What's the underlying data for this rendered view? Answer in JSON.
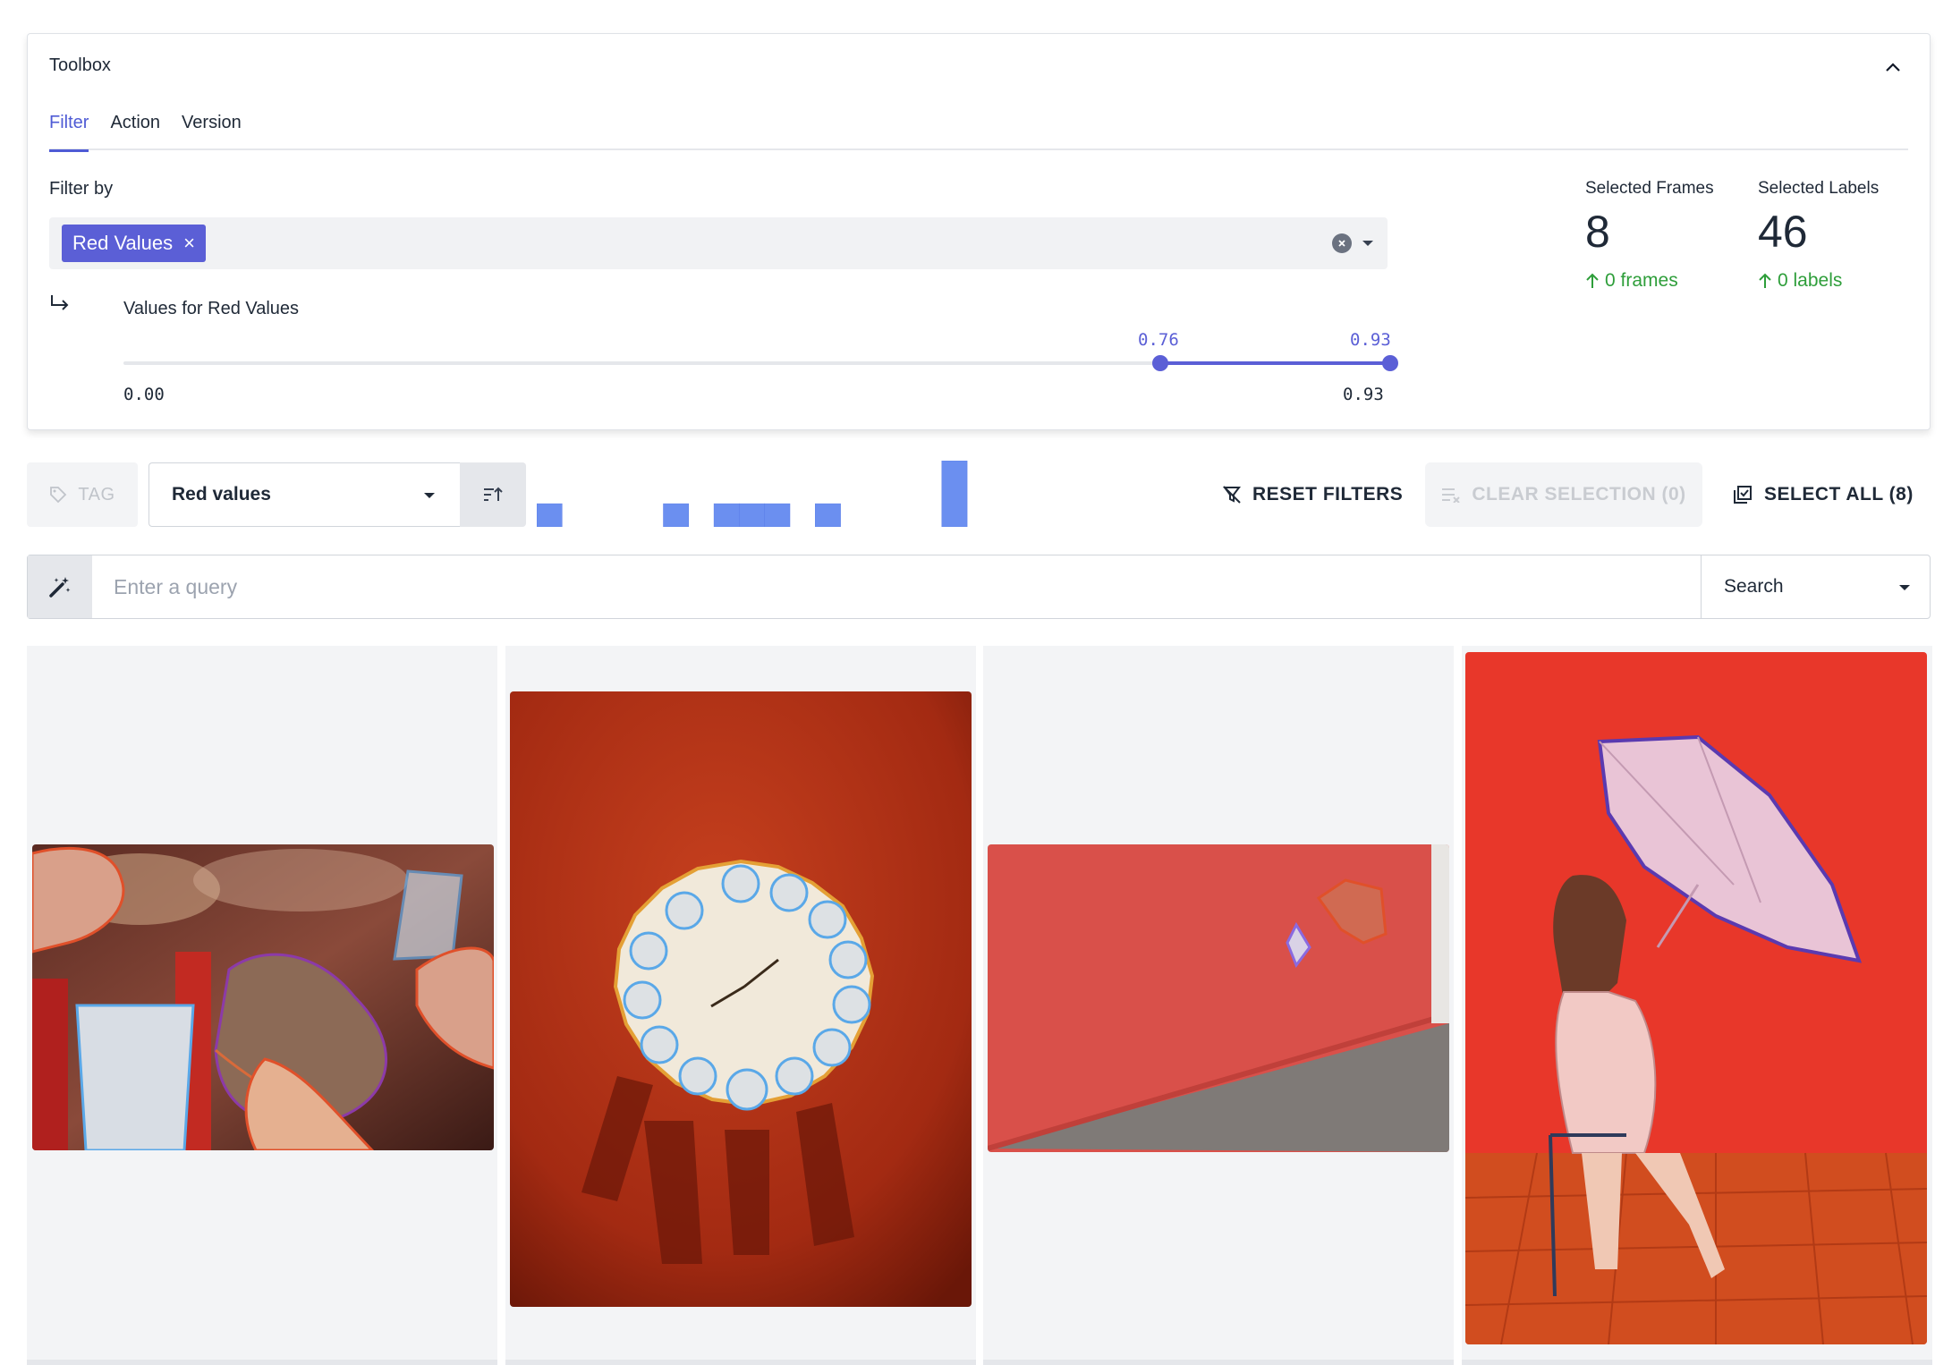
{
  "toolbox": {
    "title": "Toolbox",
    "tabs": [
      {
        "label": "Filter",
        "active": true
      },
      {
        "label": "Action",
        "active": false
      },
      {
        "label": "Version",
        "active": false
      }
    ],
    "filter_label": "Filter by",
    "filter_chip": "Red Values",
    "values_for_label": "Values for Red Values",
    "slider": {
      "min": "0.00",
      "max": "0.93",
      "low_value": "0.76",
      "high_value": "0.93"
    },
    "stats": {
      "frames": {
        "label": "Selected Frames",
        "value": "8",
        "delta": "0 frames"
      },
      "labels": {
        "label": "Selected Labels",
        "value": "46",
        "delta": "0 labels"
      }
    }
  },
  "toolbar": {
    "tag_label": "TAG",
    "metric_value": "Red values",
    "reset_label": "RESET FILTERS",
    "clear_label": "CLEAR SELECTION (0)",
    "select_all_label": "SELECT ALL (8)"
  },
  "histogram": {
    "bins": [
      0.35,
      0,
      0,
      0,
      0,
      0.35,
      0,
      0.35,
      0.35,
      0.35,
      0,
      0.35,
      0,
      0,
      0,
      0,
      1.0
    ]
  },
  "query": {
    "placeholder": "Enter a query",
    "mode": "Search"
  },
  "colors": {
    "accent": "#5b5fd6",
    "histogram_bar": "#6b8ff0",
    "success": "#2e9e3a"
  },
  "gallery": {
    "images": [
      "food-with-drinks",
      "clock-plate-on-red",
      "skater-on-red-wall",
      "girl-with-umbrella"
    ]
  }
}
